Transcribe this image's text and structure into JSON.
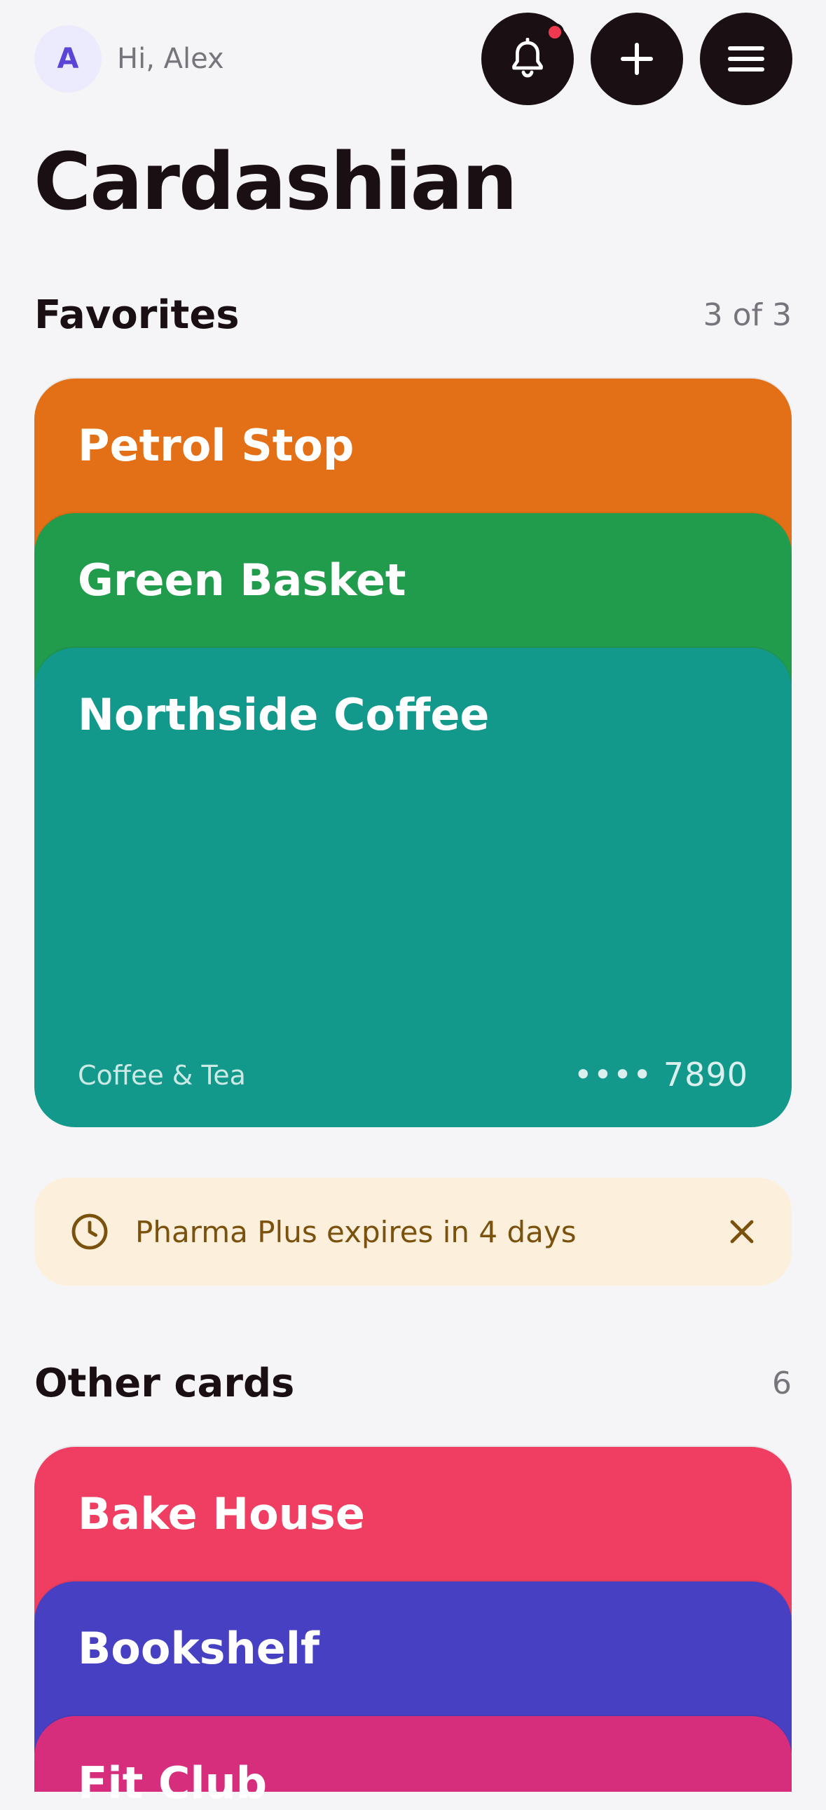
{
  "header": {
    "avatar_initial": "A",
    "greeting": "Hi, Alex",
    "has_notification": true
  },
  "app_title": "Cardashian",
  "favorites": {
    "title": "Favorites",
    "count": "3 of 3",
    "cards": [
      {
        "name": "Petrol Stop",
        "color": "#E37016"
      },
      {
        "name": "Green Basket",
        "color": "#219C4D"
      },
      {
        "name": "Northside Coffee",
        "color": "#13998B",
        "category": "Coffee & Tea",
        "number": "•••• 7890"
      }
    ]
  },
  "alert": {
    "text": "Pharma Plus expires in 4 days",
    "icon": "clock-icon",
    "close_icon": "close-icon"
  },
  "other_cards": {
    "title": "Other cards",
    "count": "6",
    "cards": [
      {
        "name": "Bake House",
        "color": "#EF3E61"
      },
      {
        "name": "Bookshelf",
        "color": "#4840C2"
      },
      {
        "name": "Fit Club",
        "color": "#D62E7C"
      }
    ]
  },
  "colors": {
    "background": "#F5F5F8",
    "dark": "#1A1014",
    "accent": "#5B45D6",
    "notification": "#F0394F",
    "alert_bg": "#FCF0DD",
    "alert_text": "#7A520E"
  }
}
